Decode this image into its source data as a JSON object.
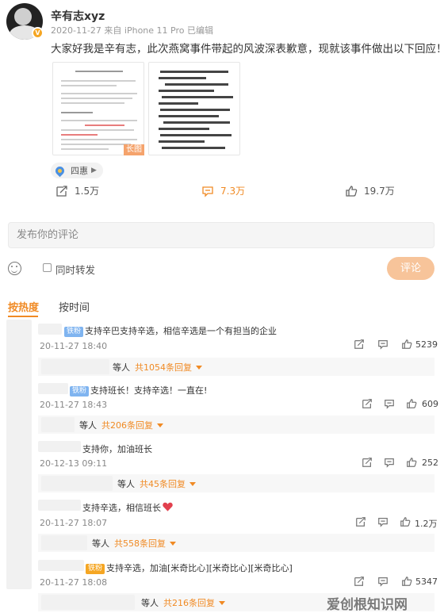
{
  "post": {
    "username": "辛有志xyz",
    "meta": "2020-11-27  来自 iPhone 11 Pro 已编辑",
    "text": "大家好我是辛有志，此次燕窝事件带起的风波深表歉意，现就该事件做出以下回应！",
    "long_image_tag": "长图",
    "location": "四惠",
    "verified_color": "#f5a623"
  },
  "actions": {
    "repost": "1.5万",
    "comment": "7.3万",
    "like": "19.7万"
  },
  "compose": {
    "placeholder": "发布你的评论",
    "repost_label": "同时转发",
    "submit_label": "评论"
  },
  "tabs": {
    "hot": "按热度",
    "time": "按时间"
  },
  "comments": [
    {
      "fan_badge": "铁粉",
      "text": "支持辛巴支持辛选，相信辛选是一个有担当的企业",
      "time": "20-11-27 18:40",
      "likes": "5239",
      "reply_prefix": "等人",
      "reply_count": "共1054条回复"
    },
    {
      "fan_badge": "铁粉",
      "text": "支持班长！支持辛选！一直在!",
      "time": "20-11-27 18:43",
      "likes": "609",
      "reply_prefix": "等人",
      "reply_count": "共206条回复"
    },
    {
      "fan_badge": "",
      "text": "支持你，加油班长",
      "time": "20-12-13 09:11",
      "likes": "252",
      "reply_prefix": "等人",
      "reply_count": "共45条回复"
    },
    {
      "fan_badge": "",
      "text": "支持辛选，相信班长",
      "time": "20-11-27 18:07",
      "likes": "1.2万",
      "reply_prefix": "等人",
      "reply_count": "共558条回复"
    },
    {
      "fan_badge": "铁粉",
      "text": "支持辛选，加油[米奇比心][米奇比心][米奇比心]",
      "time": "20-11-27 18:08",
      "likes": "5347",
      "reply_prefix": "等人",
      "reply_count": "共216条回复"
    }
  ],
  "watermark": "爱创根知识网",
  "colors": {
    "accent": "#f08a24",
    "fan_badge": "#7fb4f0",
    "heart": "#e2404e"
  }
}
